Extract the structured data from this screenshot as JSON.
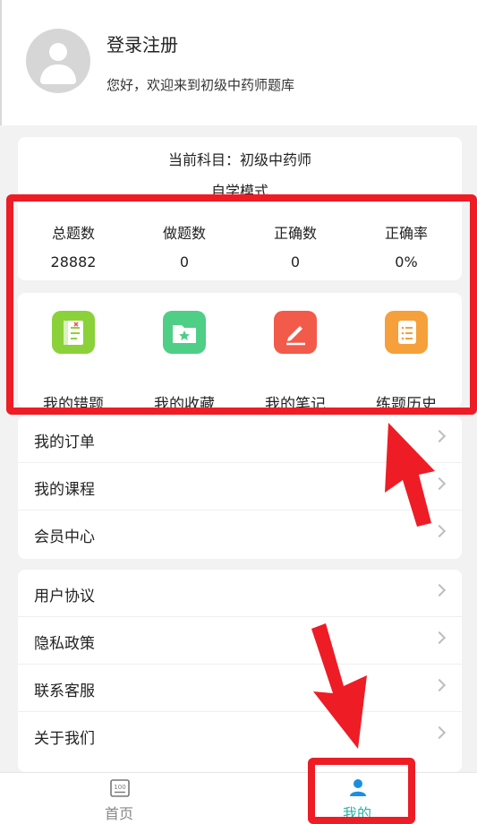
{
  "profile": {
    "title": "登录注册",
    "welcome": "您好，欢迎来到初级中药师题库",
    "avatar_icon": "user-avatar-icon"
  },
  "subject": {
    "current": "当前科目：初级中药师",
    "mode": "自学模式"
  },
  "stats": [
    {
      "label": "总题数",
      "value": "28882"
    },
    {
      "label": "做题数",
      "value": "0"
    },
    {
      "label": "正确数",
      "value": "0"
    },
    {
      "label": "正确率",
      "value": "0%"
    }
  ],
  "features": [
    {
      "label": "我的错题",
      "icon": "wrong-questions-icon",
      "color": "#8bd13a"
    },
    {
      "label": "我的收藏",
      "icon": "favorites-folder-icon",
      "color": "#4fce86"
    },
    {
      "label": "我的笔记",
      "icon": "notes-pencil-icon",
      "color": "#f25a4a"
    },
    {
      "label": "练题历史",
      "icon": "history-scroll-icon",
      "color": "#f5a03a"
    }
  ],
  "menu1": [
    {
      "label": "我的订单"
    },
    {
      "label": "我的课程"
    },
    {
      "label": "会员中心"
    }
  ],
  "menu2": [
    {
      "label": "用户协议"
    },
    {
      "label": "隐私政策"
    },
    {
      "label": "联系客服"
    },
    {
      "label": "关于我们"
    }
  ],
  "tabs": [
    {
      "label": "首页",
      "icon": "home-100-icon",
      "active": false
    },
    {
      "label": "我的",
      "icon": "user-profile-icon",
      "active": true
    }
  ],
  "colors": {
    "accent": "#2ab3a6",
    "highlight": "#ee1c25",
    "inactive": "#888888"
  }
}
